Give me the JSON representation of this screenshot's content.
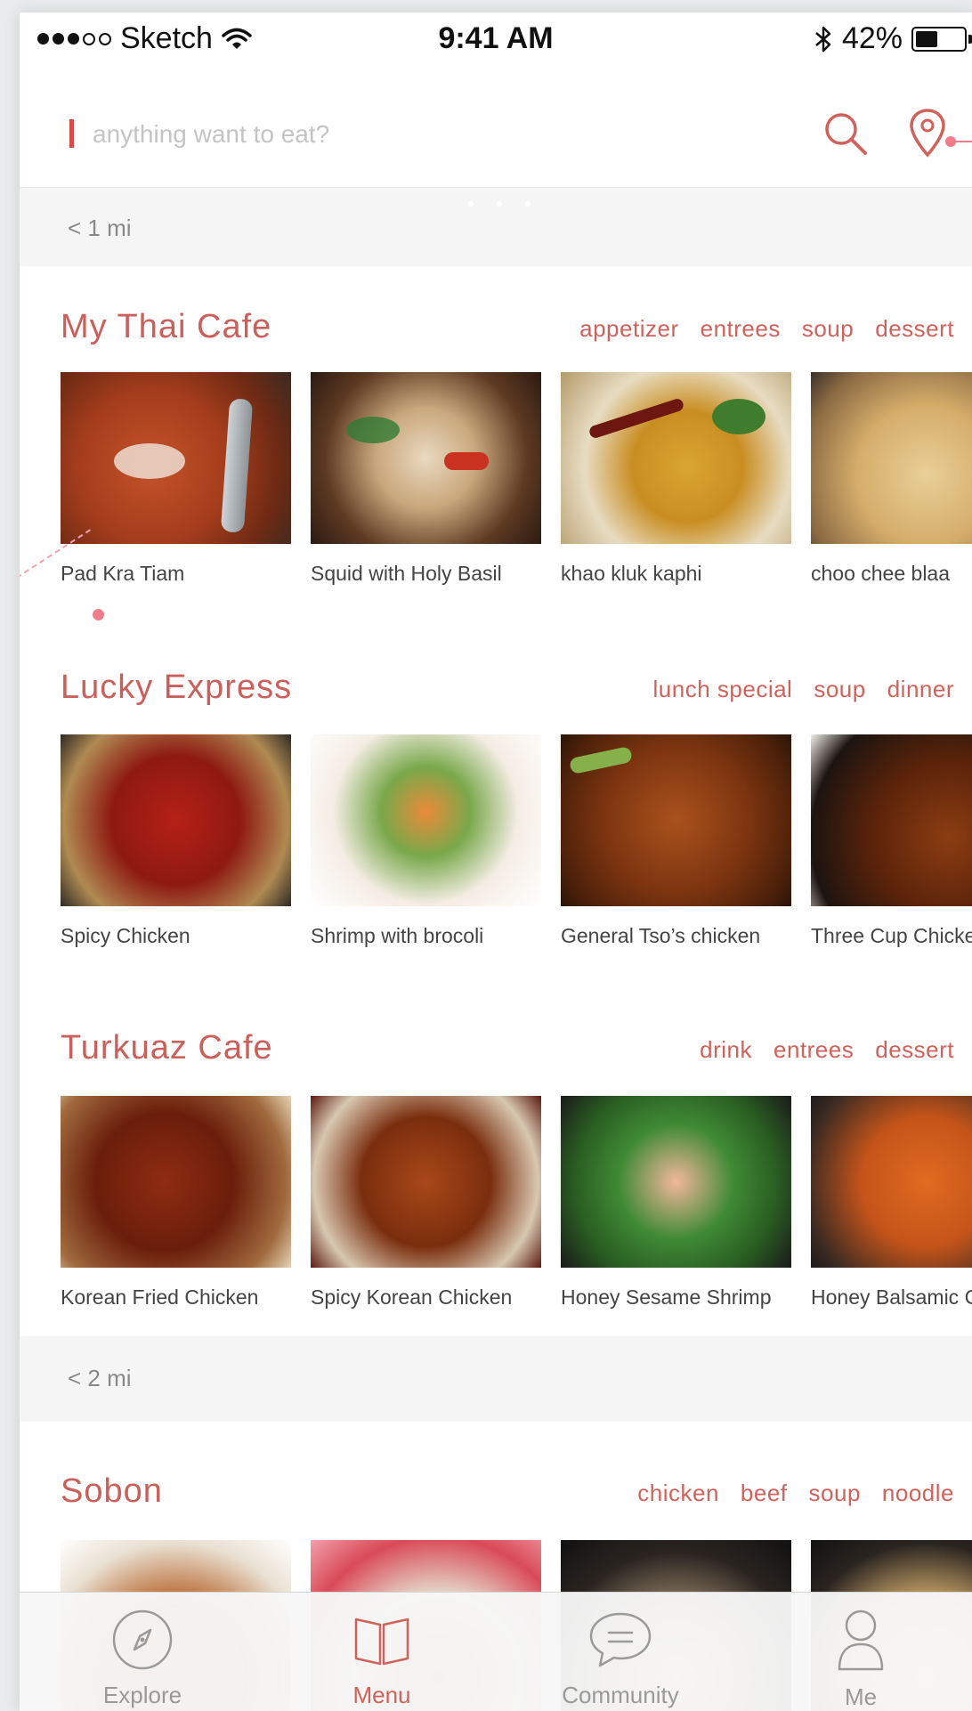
{
  "status_bar": {
    "carrier": "Sketch",
    "time": "9:41 AM",
    "battery": "42%"
  },
  "search": {
    "placeholder": "anything want to eat?"
  },
  "sections": [
    {
      "distance": "< 1 mi",
      "restaurants": [
        {
          "name": "My Thai Cafe",
          "categories": [
            "appetizer",
            "entrees",
            "soup",
            "dessert"
          ],
          "dishes": [
            "Pad Kra Tiam",
            "Squid with Holy Basil",
            "khao kluk kaphi",
            "choo chee blaa"
          ]
        },
        {
          "name": "Lucky Express",
          "categories": [
            "lunch special",
            "soup",
            "dinner"
          ],
          "dishes": [
            "Spicy Chicken",
            "Shrimp with brocoli",
            "General Tso’s chicken",
            "Three Cup Chicke"
          ]
        },
        {
          "name": "Turkuaz Cafe",
          "categories": [
            "drink",
            "entrees",
            "dessert"
          ],
          "dishes": [
            "Korean Fried Chicken",
            "Spicy Korean Chicken",
            "Honey Sesame Shrimp",
            "Honey Balsamic C"
          ]
        }
      ]
    },
    {
      "distance": "< 2 mi",
      "restaurants": [
        {
          "name": "Sobon",
          "categories": [
            "chicken",
            "beef",
            "soup",
            "noodle"
          ],
          "dishes": [
            "",
            "",
            "",
            ""
          ]
        }
      ]
    }
  ],
  "tab_bar": {
    "tabs": [
      {
        "label": "Explore",
        "icon": "compass-icon",
        "active": false
      },
      {
        "label": "Menu",
        "icon": "book-icon",
        "active": true
      },
      {
        "label": "Community",
        "icon": "chat-bubble-icon",
        "active": false
      },
      {
        "label": "Me",
        "icon": "person-icon",
        "active": false
      }
    ]
  },
  "colors": {
    "accent": "#d0625c",
    "annotation": "#f07c8c",
    "banner_bg": "#f5f5f5"
  }
}
